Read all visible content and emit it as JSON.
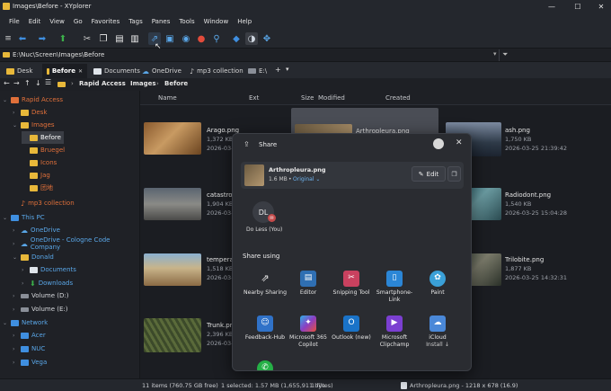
{
  "window": {
    "title": "Images\\Before - XYplorer",
    "minimize": "—",
    "maximize": "☐",
    "close": "✕"
  },
  "menu": [
    "File",
    "Edit",
    "View",
    "Go",
    "Favorites",
    "Tags",
    "Panes",
    "Tools",
    "Window",
    "Help"
  ],
  "address": {
    "path": "E:\\Nuc\\Screen\\Images\\Before"
  },
  "tabs": [
    {
      "label": "Desk"
    },
    {
      "label": "Before",
      "close": "✕"
    },
    {
      "label": "Documents"
    },
    {
      "label": "OneDrive"
    },
    {
      "label": "mp3 collection"
    },
    {
      "label": "E:\\"
    }
  ],
  "tab_add": "+",
  "tab_menu": "▾",
  "breadcrumb": [
    "Rapid Access",
    "Images",
    "Before"
  ],
  "tree": {
    "items": [
      {
        "label": "Rapid Access",
        "color": "#e0703a"
      },
      {
        "label": "Desk",
        "color": "#e0703a"
      },
      {
        "label": "Images",
        "color": "#e0703a"
      },
      {
        "label": "Before",
        "color": "#ffffff"
      },
      {
        "label": "Bruegel",
        "color": "#e0703a"
      },
      {
        "label": "Icons",
        "color": "#e0703a"
      },
      {
        "label": "Jag",
        "color": "#e0703a"
      },
      {
        "label": "团地",
        "color": "#e0703a"
      },
      {
        "label": "mp3 collection",
        "color": "#e0703a"
      },
      {
        "label": "This PC",
        "color": "#5aa7e8"
      },
      {
        "label": "OneDrive",
        "color": "#5aa7e8"
      },
      {
        "label": "OneDrive - Cologne Code Company",
        "color": "#5aa7e8"
      },
      {
        "label": "Donald",
        "color": "#5aa7e8"
      },
      {
        "label": "Documents",
        "color": "#5aa7e8"
      },
      {
        "label": "Downloads",
        "color": "#5aa7e8"
      },
      {
        "label": "Volume (D:)",
        "color": "#d6d8dc"
      },
      {
        "label": "Volume (E:)",
        "color": "#d6d8dc"
      },
      {
        "label": "Network",
        "color": "#5aa7e8"
      },
      {
        "label": "Acer",
        "color": "#5aa7e8"
      },
      {
        "label": "NUC",
        "color": "#5aa7e8"
      },
      {
        "label": "Vega",
        "color": "#5aa7e8"
      }
    ]
  },
  "columns": [
    "Name",
    "Ext",
    "Size",
    "Modified",
    "Created"
  ],
  "files": [
    {
      "name": "Arago.png",
      "size": "1,372 KB",
      "date": "2026-03-2"
    },
    {
      "name": "Arthropleura.png",
      "size": "",
      "date": ""
    },
    {
      "name": "ash.png",
      "size": "1,750 KB",
      "date": "2026-03-25 21:39:42"
    },
    {
      "name": "catastrop",
      "size": "1,904 KB",
      "date": "2026-03-2"
    },
    {
      "name": "Radiodont.png",
      "size": "1,540 KB",
      "date": "2026-03-25 15:04:28"
    },
    {
      "name": "temperat",
      "size": "1,518 KB",
      "date": "2026-03-2"
    },
    {
      "name": "Trilobite.png",
      "size": "1,877 KB",
      "date": "2026-03-25 14:32:31"
    },
    {
      "name": "Trunk.png",
      "size": "2,396 KB",
      "date": "2026-03-2"
    }
  ],
  "share": {
    "title": "Share",
    "file_name": "Arthropleura.png",
    "file_size": "1.6 MB",
    "file_sep": "•",
    "file_quality": "Original",
    "edit_label": "Edit",
    "contact": {
      "initials": "DL",
      "name": "Do Less (You)"
    },
    "share_using_label": "Share using",
    "apps": [
      {
        "label": "Nearby Sharing",
        "icon": "nearby-sharing-icon",
        "color": "#3a3d44"
      },
      {
        "label": "Editor",
        "icon": "editor-icon",
        "color": "#2f6fb3"
      },
      {
        "label": "Snipping Tool",
        "icon": "snipping-tool-icon",
        "color": "#c9415f"
      },
      {
        "label": "Smartphone-Link",
        "icon": "smartphone-link-icon",
        "color": "#2b86d6"
      },
      {
        "label": "Paint",
        "icon": "paint-icon",
        "color": "#3aa0d8"
      },
      {
        "label": "Feedback-Hub",
        "icon": "feedback-hub-icon",
        "color": "#3072c8"
      },
      {
        "label": "Microsoft 365 Copilot",
        "icon": "copilot-icon",
        "color": "#8a3fc4"
      },
      {
        "label": "Outlook (new)",
        "icon": "outlook-icon",
        "color": "#1a73c8"
      },
      {
        "label": "Microsoft Clipchamp",
        "icon": "clipchamp-icon",
        "color": "#7b3fd1"
      },
      {
        "label": "iCloud",
        "sub": "Install ↓",
        "icon": "icloud-icon",
        "color": "#4a88d8"
      },
      {
        "label": "",
        "icon": "whatsapp-icon",
        "color": "#25b046"
      }
    ]
  },
  "status": {
    "items": "11 items (760.75 GB free)",
    "selected": "1 selected: 1.57 MB (1,655,911 bytes)",
    "file_count": "1 file",
    "preview": "Arthropleura.png - 1218 x 678 (16.9)"
  }
}
